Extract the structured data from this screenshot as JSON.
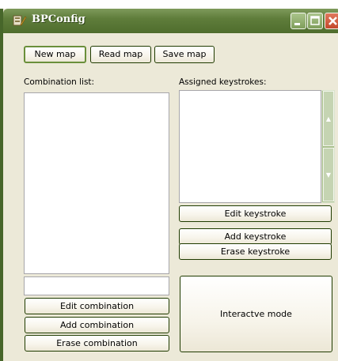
{
  "window": {
    "title": "BPConfig",
    "app_icon": "bpconfig-app-icon",
    "controls": {
      "minimize_icon": "minimize-icon",
      "maximize_icon": "maximize-icon",
      "close_icon": "close-icon"
    }
  },
  "toolbar": {
    "new_map": "New map",
    "read_map": "Read map",
    "save_map": "Save map"
  },
  "combination": {
    "label": "Combination list:",
    "input_value": "",
    "edit": "Edit combination",
    "add": "Add combination",
    "erase": "Erase combination"
  },
  "keystrokes": {
    "label": "Assigned keystrokes:",
    "edit": "Edit keystroke",
    "add": "Add keystroke",
    "erase": "Erase keystroke"
  },
  "interactive_mode": "Interactve mode",
  "colors": {
    "titlebar": "#5f7d3b",
    "window_bg": "#ece9d8",
    "close_button": "#c4492c"
  }
}
